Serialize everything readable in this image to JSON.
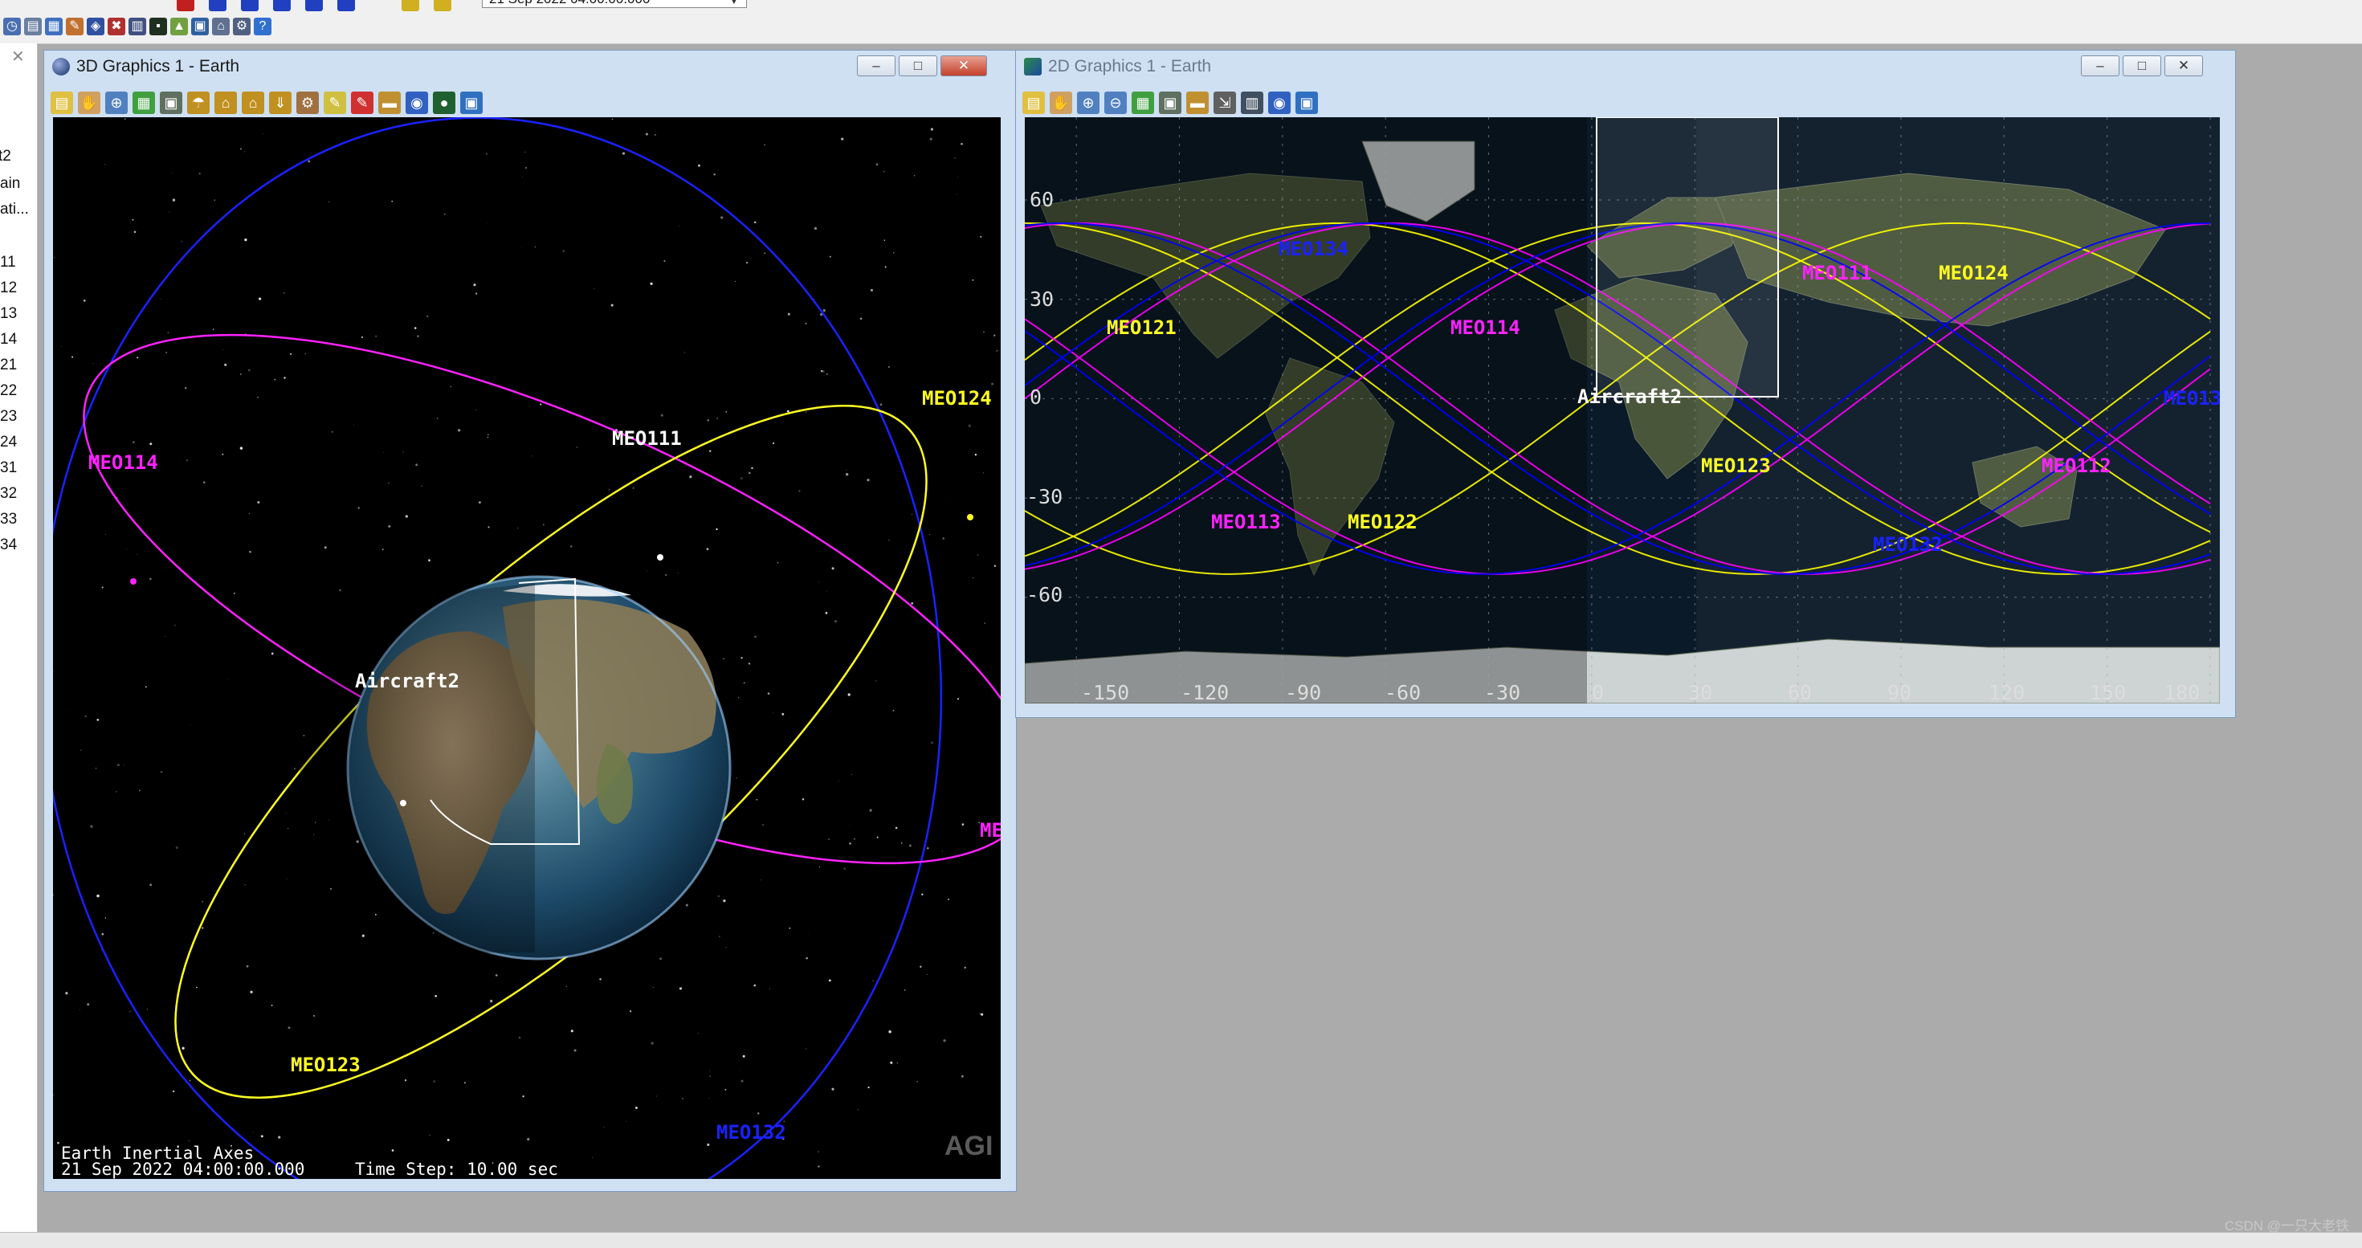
{
  "top_toolbar": {
    "date_value": "21 Sep 2022 04:00:00.000"
  },
  "left_panel": {
    "items": [
      "t2",
      "ain",
      "ati...",
      "11",
      "12",
      "13",
      "14",
      "21",
      "22",
      "23",
      "24",
      "31",
      "32",
      "33",
      "34"
    ]
  },
  "window3d": {
    "title": "3D Graphics 1 - Earth",
    "minimize": "–",
    "maximize": "□",
    "close": "✕",
    "overlay": {
      "axes_label": "Earth Inertial Axes",
      "datetime": "21 Sep 2022 04:00:00.000",
      "time_step": "Time Step: 10.00 sec"
    },
    "logo": "AGI",
    "labels": {
      "aircraft": "Aircraft2",
      "meo111": "MEO111",
      "meo124": "MEO124",
      "meo114": "MEO114",
      "meo123": "MEO123",
      "meo132": "MEO132",
      "meo_edge": "ME"
    }
  },
  "window2d": {
    "title": "2D Graphics 1 - Earth",
    "minimize": "–",
    "maximize": "□",
    "close": "✕",
    "lat_ticks": [
      "60",
      "30",
      "0",
      "-30",
      "-60"
    ],
    "lon_ticks": [
      "-150",
      "-120",
      "-90",
      "-60",
      "-30",
      "0",
      "30",
      "60",
      "90",
      "120",
      "150",
      "180"
    ],
    "labels": {
      "meo134": "MEO134",
      "meo121": "MEO121",
      "meo114": "MEO114",
      "meo111": "MEO111",
      "meo124": "MEO124",
      "aircraft": "Aircraft2",
      "meo123": "MEO123",
      "meo112": "MEO112",
      "meo113": "MEO113",
      "meo122": "MEO122",
      "meo132": "MEO132",
      "meo13_edge": "MEO13"
    }
  },
  "colors": {
    "plane1": "#ffff00",
    "plane2": "#ff00ff",
    "plane3": "#0000ff",
    "aircraft": "#ffffff"
  },
  "watermark": "CSDN @一只大老铁"
}
